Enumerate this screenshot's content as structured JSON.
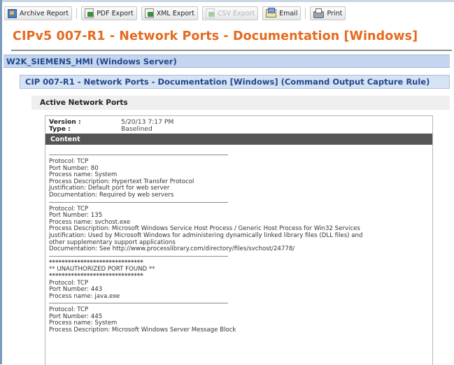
{
  "toolbar": {
    "archive_report": "Archive Report",
    "pdf_export": "PDF Export",
    "xml_export": "XML Export",
    "csv_export": "CSV Export",
    "email": "Email",
    "print": "Print"
  },
  "header": {
    "title": "CIPv5 007-R1 - Network Ports - Documentation [Windows]",
    "server": "W2K_SIEMENS_HMI (Windows Server)",
    "rule": "CIP 007-R1 - Network Ports - Documentation [Windows] (Command Output Capture Rule)",
    "section": "Active Network Ports"
  },
  "meta": {
    "version_label": "Version :",
    "version_value": "5/20/13 7:17 PM",
    "type_label": "Type :",
    "type_value": "Baselined"
  },
  "content": {
    "heading": "Content",
    "blocks": [
      {
        "protocol": "Protocol: TCP",
        "port": "Port Number: 80",
        "process": "Process name: System",
        "description": "Process Description: Hypertext Transfer Protocol",
        "justification": "Justification: Default port for web server",
        "documentation": "Documentation: Required by web servers"
      },
      {
        "protocol": "Protocol: TCP",
        "port": "Port Number: 135",
        "process": "Process name: svchost.exe",
        "description": "Process Description: Microsoft Windows Service Host Process / Generic Host Process for Win32 Services",
        "justification_1": "Justification: Used by Microsoft Windows for administering dynamically linked library files (DLL files) and",
        "justification_2": "other supplementary support applications",
        "documentation": "Documentation: See http://www.processlibrary.com/directory/files/svchost/24778/"
      },
      {
        "stars": "******************************",
        "warning": "** UNAUTHORIZED PORT FOUND **",
        "stars2": "******************************",
        "protocol": "Protocol: TCP",
        "port": "Port Number: 443",
        "process": "Process name: java.exe"
      },
      {
        "protocol": "Protocol: TCP",
        "port": "Port Number: 445",
        "process": "Process name: System",
        "description": "Process Description: Microsoft Windows Server Message Block"
      }
    ]
  }
}
